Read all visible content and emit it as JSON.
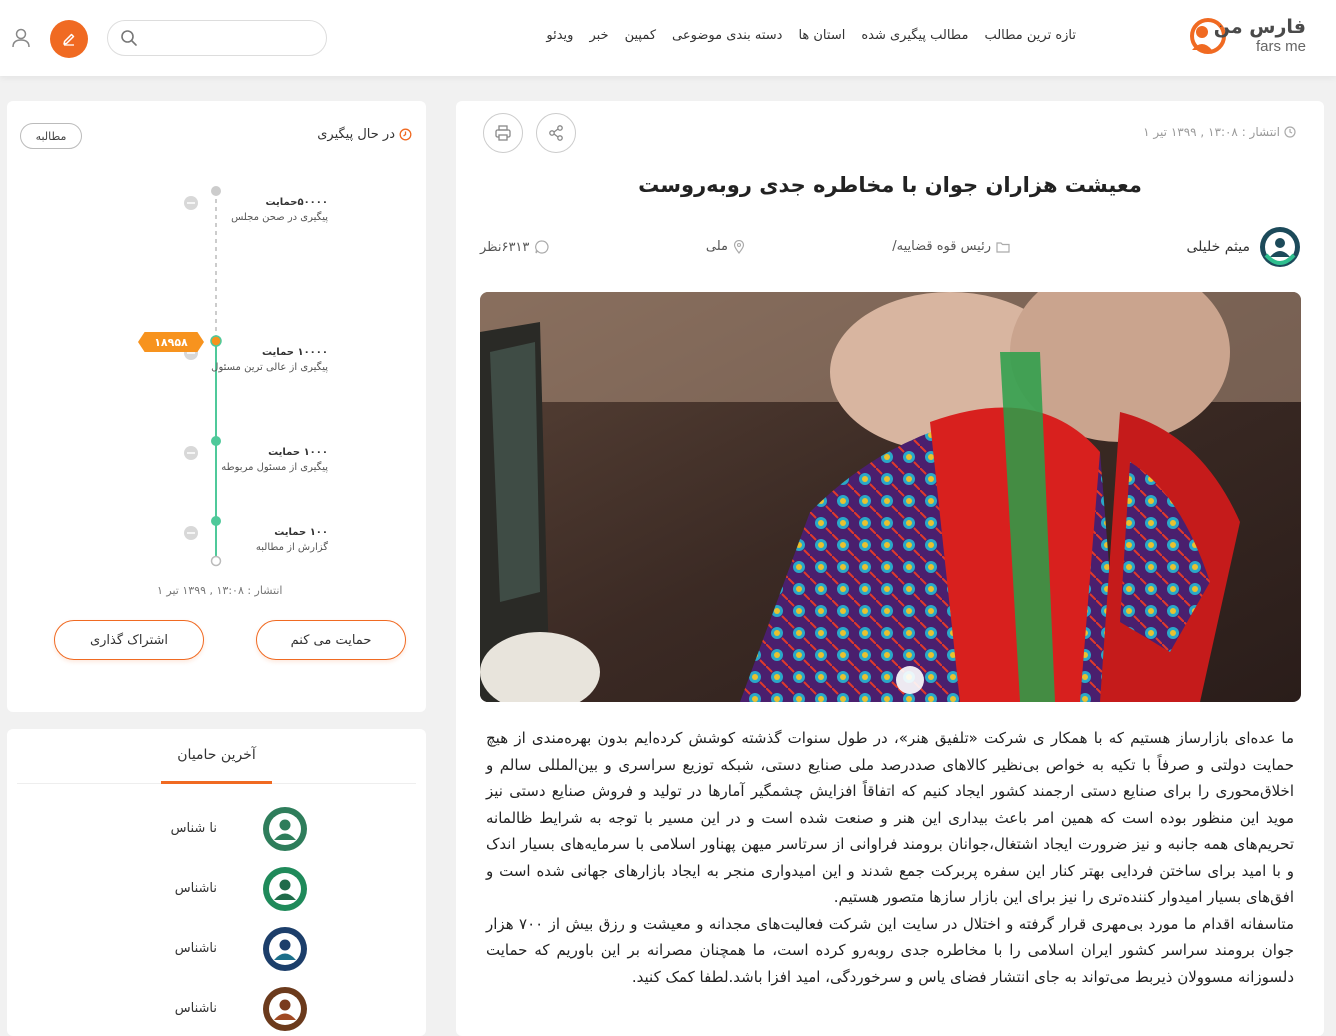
{
  "header": {
    "logo_fa": "فارس من",
    "logo_en": "fars me",
    "nav": [
      "تازه ترین مطالب",
      "مطالب پیگیری شده",
      "استان ها",
      "دسته بندی موضوعی",
      "کمپین",
      "خبر",
      "ویدئو"
    ],
    "search_placeholder": "",
    "accent": "#f06a22"
  },
  "article": {
    "pub_date": "انتشار : ۱۳:۰۸ , ۱۳۹۹ تیر ۱",
    "title": "معیشت هزاران جوان با مخاطره جدی روبه‌روست",
    "author": "میثم خلیلی",
    "category": "رئیس قوه قضاییه/",
    "location": "ملی",
    "views": "۶۳۱۳نظر",
    "paragraphs": [
      "ما عده‌ای بازارساز هستیم که با همکار ی شرکت «تلفیق هنر»، در طول سنوات گذشته کوشش کرده‌ایم بدون بهره‌مندی از هیچ حمایت دولتی و صرفاً با تکیه به خواص بی‌نظیر کالاهای صددرصد ملی صنایع دستی، شبکه توزیع سراسری و بین‌المللی سالم و اخلاق‌محوری را برای صنایع دستی ارجمند کشور ایجاد کنیم که اتفاقاً افزایش چشمگیر آمارها در تولید و فروش صنایع دستی نیز موید این منظور بوده است که همین امر باعث بیداری این هنر و صنعت شده است و در این مسیر با توجه به شرایط ظالمانه تحریم‌های همه جانبه و نیز ضرورت ایجاد اشتغال،جوانان برومند فراوانی از سرتاسر میهن پهناور اسلامی با سرمایه‌های بسیار اندک و با امید برای ساختن فردایی بهتر کنار این سفره پربرکت جمع شدند و این امیدواری منجر به ایجاد بازارهای جهانی شده است و افق‌های بسیار امیدوار کننده‌تری را نیز برای این بازار سازها متصور هستیم.",
      "متاسفانه اقدام ما مورد بی‌مهری قرار گرفته و اختلال در سایت این شرکت فعالیت‌های مجدانه و معیشت و رزق بیش از ۷۰۰ هزار جوان برومند سراسر کشور ایران اسلامی را با مخاطره جدی روبه‌رو کرده است، ما همچنان مصرانه بر این باوریم که حمایت دلسوزانه مسوولان ذیربط می‌تواند به جای انتشار فضای یاس و سرخوردگی، امید افزا باشد.لطفا کمک کنید."
    ]
  },
  "track": {
    "title": "در حال پیگیری",
    "tag": "مطالبه",
    "badge": "۱۸۹۵۸",
    "progress_supporters": 18958,
    "steps": [
      {
        "amount": "۵۰۰۰۰حمایت",
        "desc": "پیگیری در صحن مجلس"
      },
      {
        "amount": "۱۰۰۰۰ حمایت",
        "desc": "پیگیری از عالی ترین مسئول"
      },
      {
        "amount": "۱۰۰۰ حمایت",
        "desc": "پیگیری از مسئول مربوطه"
      },
      {
        "amount": "۱۰۰ حمایت",
        "desc": "گزارش از مطالبه"
      }
    ],
    "date": "انتشار : ۱۳:۰۸ , ۱۳۹۹ تیر ۱",
    "support_btn": "حمایت می کنم",
    "share_btn": "اشتراک گذاری"
  },
  "supporters": {
    "title": "آخرین حامیان",
    "items": [
      {
        "name": "نا شناس",
        "color": "#2e7d5b"
      },
      {
        "name": "ناشناس",
        "color": "#1f8a5a"
      },
      {
        "name": "ناشناس",
        "color": "#1c6f8a"
      },
      {
        "name": "ناشناس",
        "color": "#7a3b1e"
      }
    ]
  }
}
